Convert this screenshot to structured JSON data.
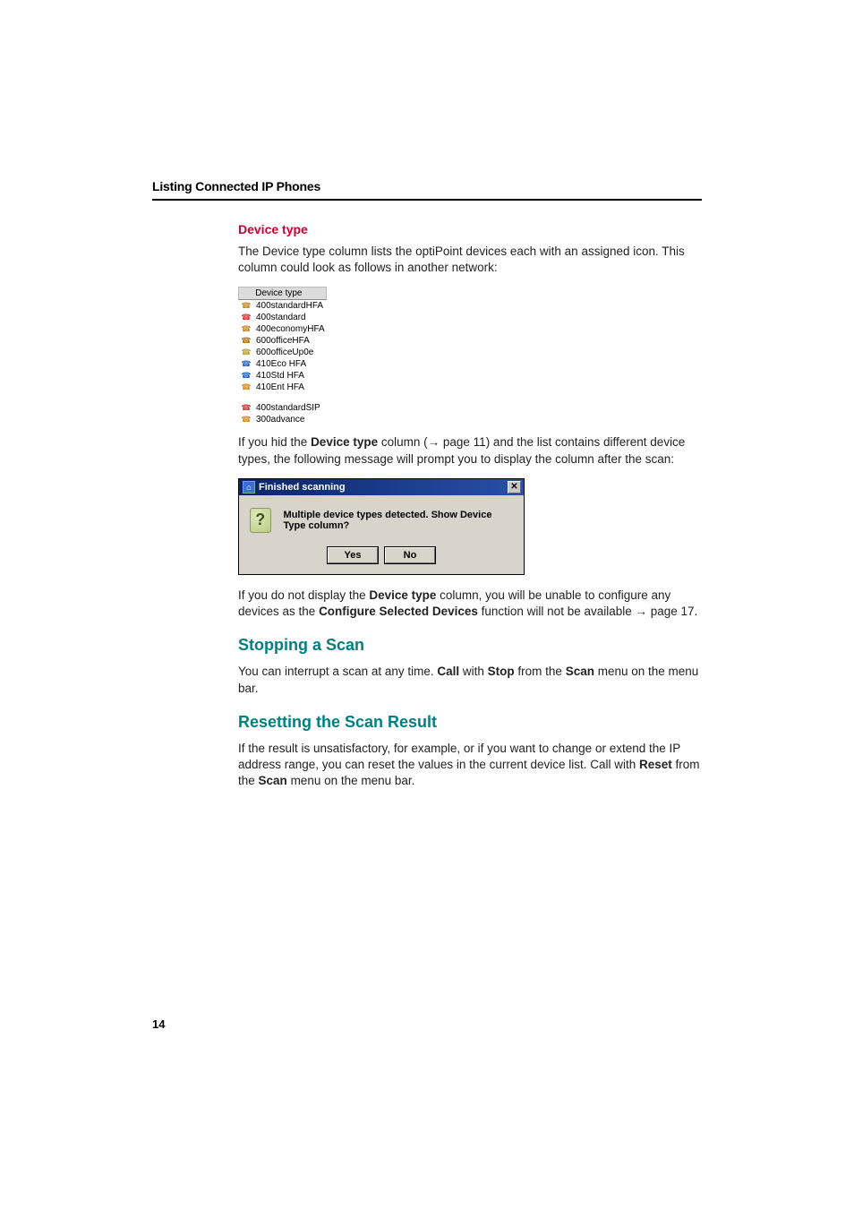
{
  "header": {
    "title": "Listing Connected IP Phones"
  },
  "sections": {
    "deviceType": {
      "heading": "Device type",
      "intro": "The Device type column lists the optiPoint devices each with an assigned icon. This column could look as follows in another network:",
      "column": {
        "header": "Device type",
        "rowsA": [
          {
            "label": "400standardHFA",
            "color": "#c08820"
          },
          {
            "label": "400standard",
            "color": "#cc3333"
          },
          {
            "label": "400economyHFA",
            "color": "#c08820"
          },
          {
            "label": "600officeHFA",
            "color": "#b07010"
          },
          {
            "label": "600officeUp0e",
            "color": "#b8a030"
          },
          {
            "label": "410Eco HFA",
            "color": "#2060c0"
          },
          {
            "label": "410Std HFA",
            "color": "#2060c0"
          },
          {
            "label": "410Ent HFA",
            "color": "#d88820"
          }
        ],
        "rowsB": [
          {
            "label": "400standardSIP",
            "color": "#cc3333"
          },
          {
            "label": "300advance",
            "color": "#d88820"
          }
        ]
      },
      "afterColumn_pre": "If you hid the ",
      "afterColumn_bold1": "Device type",
      "afterColumn_mid": " column (",
      "afterColumn_arrow": "→",
      "afterColumn_pageref": " page 11) and the list contains different device types, the following message will prompt you to display the column after the scan:",
      "dialog": {
        "title": "Finished scanning",
        "message": "Multiple device types detected. Show Device Type column?",
        "yes": "Yes",
        "no": "No"
      },
      "afterDialog_pre": "If you do not display the ",
      "afterDialog_bold1": "Device type",
      "afterDialog_mid1": " column, you will be unable to configure any devices as the ",
      "afterDialog_bold2": "Configure Selected Devices",
      "afterDialog_mid2": " function will not be available ",
      "afterDialog_arrow": "→",
      "afterDialog_pageref": " page 17."
    },
    "stopping": {
      "heading": "Stopping a Scan",
      "text_pre": "You can interrupt a scan at any time. ",
      "text_b1": "Call",
      "text_mid1": " with ",
      "text_b2": "Stop",
      "text_mid2": " from the ",
      "text_b3": "Scan",
      "text_post": " menu on the menu bar."
    },
    "resetting": {
      "heading": "Resetting the Scan Result",
      "text_pre": "If the result is unsatisfactory, for example, or if you want to change or extend the IP address range, you can reset the values in the current device list. Call with ",
      "text_b1": "Reset",
      "text_mid1": " from the ",
      "text_b2": "Scan",
      "text_post": " menu on the menu bar."
    }
  },
  "pageNumber": "14"
}
